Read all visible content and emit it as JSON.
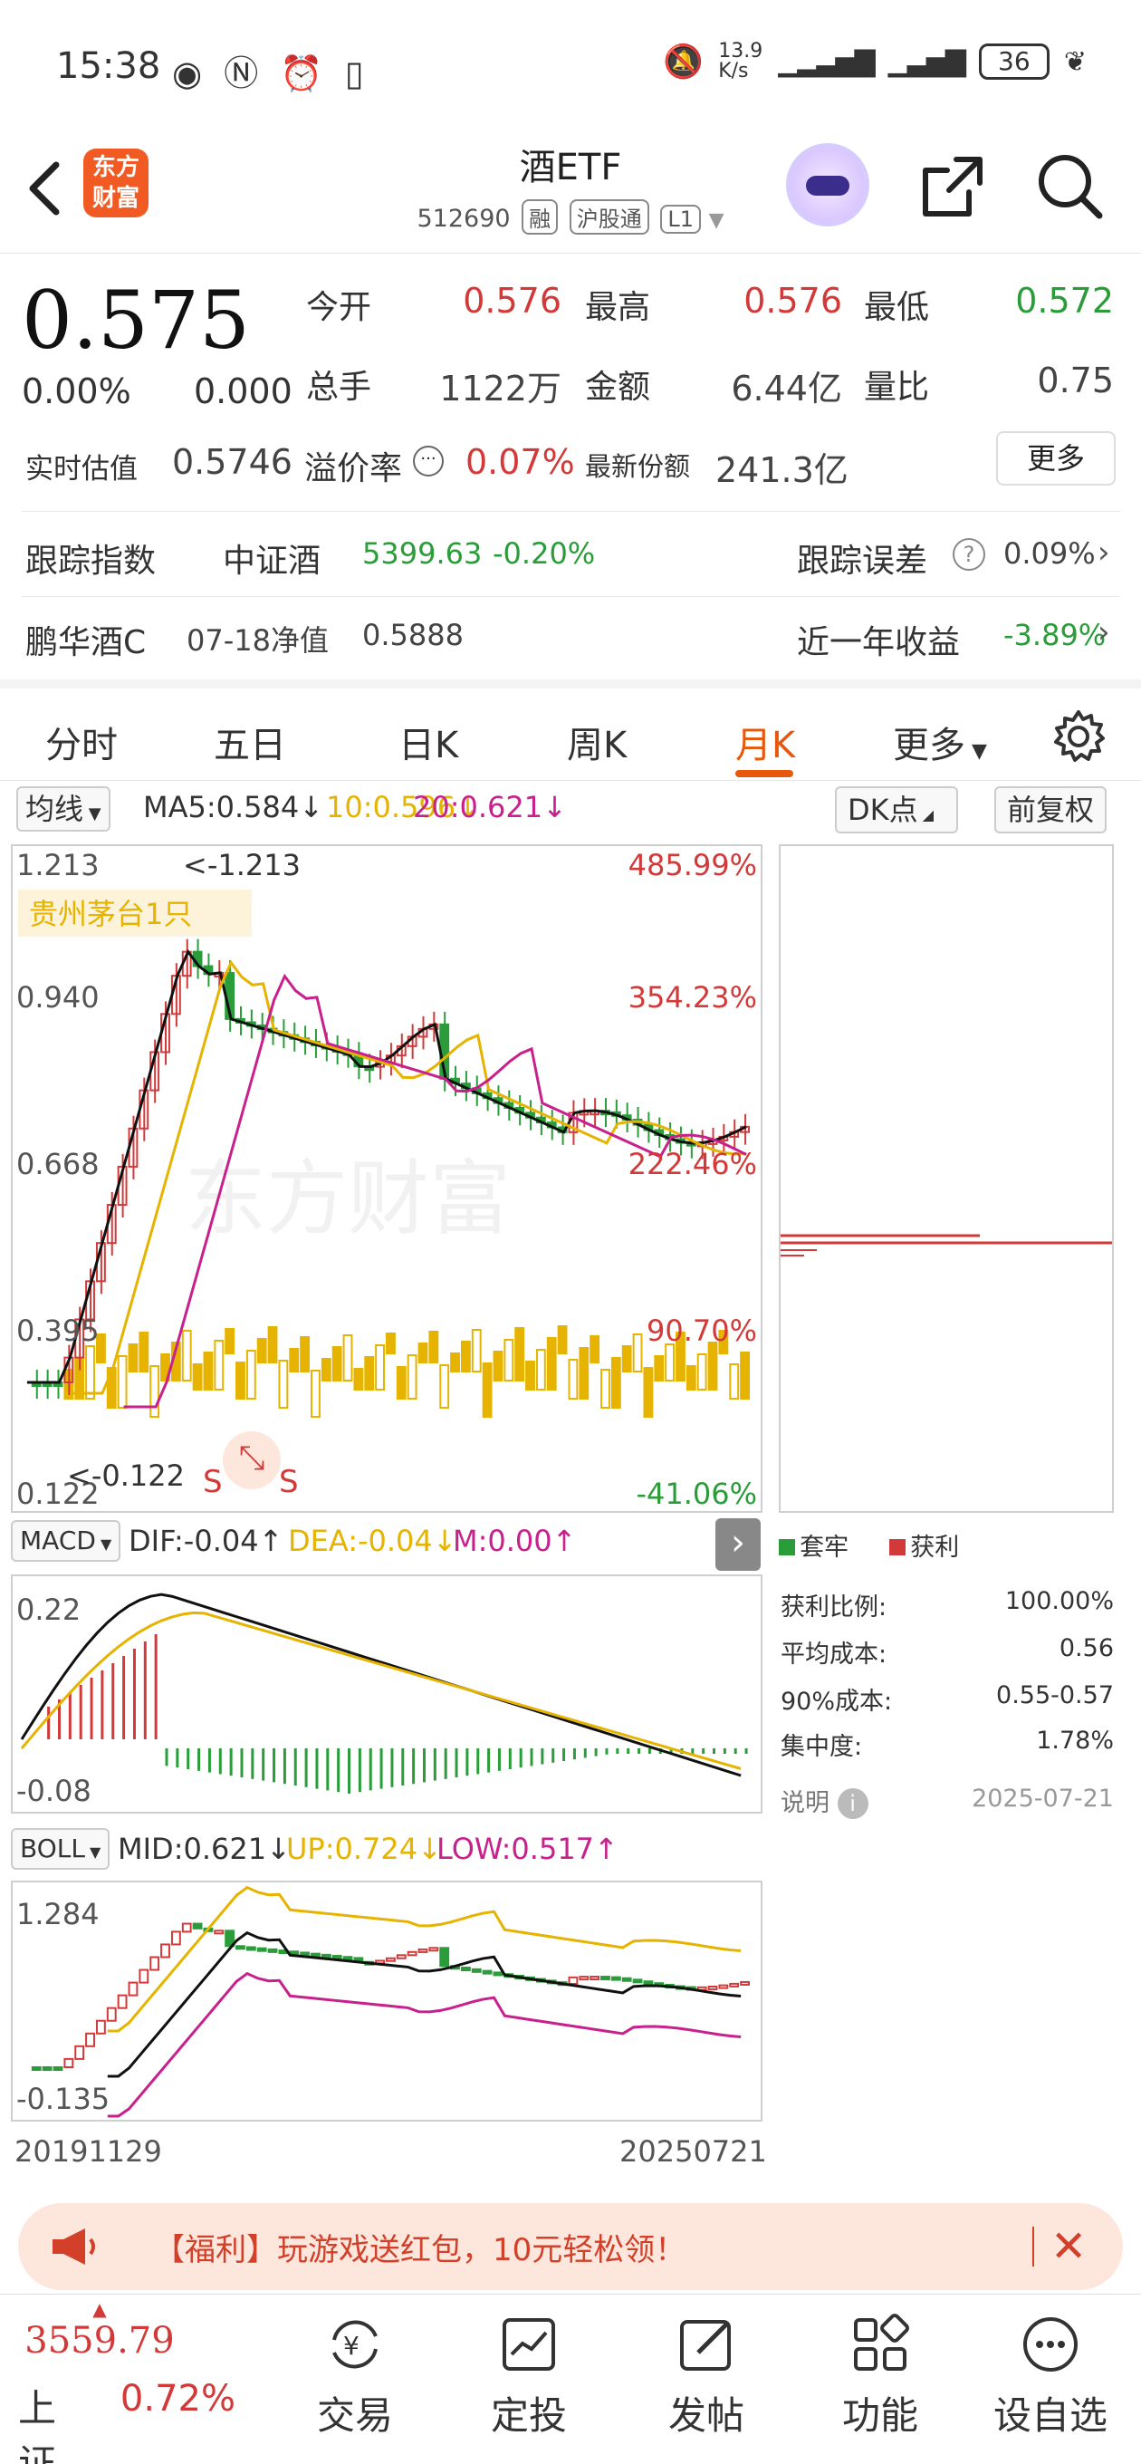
{
  "status_bar": {
    "time": "15:38",
    "net_speed": "13.9\nK/s",
    "battery": "36"
  },
  "header": {
    "back_icon": "back-arrow-icon",
    "logo_line1": "东方",
    "logo_line2": "财富",
    "title": "酒ETF",
    "code": "512690",
    "tags": [
      "融",
      "沪股通",
      "L1"
    ],
    "share_icon": "share-icon",
    "search_icon": "search-icon"
  },
  "quote": {
    "price": "0.575",
    "change_pct": "0.00%",
    "change_abs": "0.000",
    "open_label": "今开",
    "open": "0.576",
    "high_label": "最高",
    "high": "0.576",
    "low_label": "最低",
    "low": "0.572",
    "volume_label": "总手",
    "volume": "1122万",
    "amount_label": "金额",
    "amount": "6.44亿",
    "ratio_label": "量比",
    "ratio": "0.75",
    "iopv_label": "实时估值",
    "iopv": "0.5746",
    "premium_label": "溢价率",
    "premium": "0.07%",
    "shares_label": "最新份额",
    "shares": "241.3亿",
    "more_label": "更多",
    "track_label": "跟踪指数",
    "track_name": "中证酒",
    "track_value": "5399.63",
    "track_change": "-0.20%",
    "error_label": "跟踪误差",
    "error_value": "0.09%",
    "fund_name": "鹏华酒C",
    "nav_label": "07-18净值",
    "nav_value": "0.5888",
    "year_label": "近一年收益",
    "year_value": "-3.89%"
  },
  "tabs": {
    "items": [
      "分时",
      "五日",
      "日K",
      "周K",
      "月K",
      "更多"
    ],
    "active": "月K"
  },
  "ma_row": {
    "select": "均线",
    "ma5": "MA5:0.584↓",
    "ma10": "10:0.596↓",
    "ma20": "20:0.621↓",
    "dk_select": "DK点",
    "adjust_button": "前复权"
  },
  "kline": {
    "y_ticks": [
      "1.213",
      "0.940",
      "0.668",
      "0.395",
      "0.122"
    ],
    "pct_ticks": [
      "485.99%",
      "354.23%",
      "222.46%",
      "90.70%",
      "-41.06%"
    ],
    "high_marker": "<-1.213",
    "low_marker": "<-0.122",
    "event_label": "贵州茅台1只",
    "s_marker": "S",
    "watermark": "东方财富"
  },
  "macd": {
    "select": "MACD",
    "dif": "DIF:-0.04↑",
    "dea": "DEA:-0.04↓",
    "m": "M:0.00↑",
    "y_ticks": [
      "0.22",
      "-0.08"
    ]
  },
  "boll": {
    "select": "BOLL",
    "mid": "MID:0.621↓",
    "up": "UP:0.724↓",
    "low": "LOW:0.517↑",
    "y_ticks": [
      "1.284",
      "-0.135"
    ]
  },
  "x_axis": {
    "start": "20191129",
    "end": "20250721"
  },
  "chips": {
    "legend_trapped": "套牢",
    "legend_profit": "获利",
    "rows": [
      {
        "label": "获利比例:",
        "value": "100.00%"
      },
      {
        "label": "平均成本:",
        "value": "0.56"
      },
      {
        "label": "90%成本:",
        "value": "0.55-0.57"
      },
      {
        "label": "集中度:",
        "value": "1.78%"
      }
    ],
    "note_label": "说明",
    "date": "2025-07-21"
  },
  "banner": {
    "text": "【福利】玩游戏送红包，10元轻松领！"
  },
  "bottom_nav": {
    "index_value": "3559.79",
    "index_name": "上证",
    "index_change": "0.72%",
    "items": [
      "交易",
      "定投",
      "发帖",
      "功能",
      "设自选"
    ]
  },
  "colors": {
    "up": "#d23a3a",
    "down": "#2a9d3a",
    "accent": "#e8580c",
    "ma5": "#111111",
    "ma10": "#e6b400",
    "ma20": "#c8208c"
  }
}
